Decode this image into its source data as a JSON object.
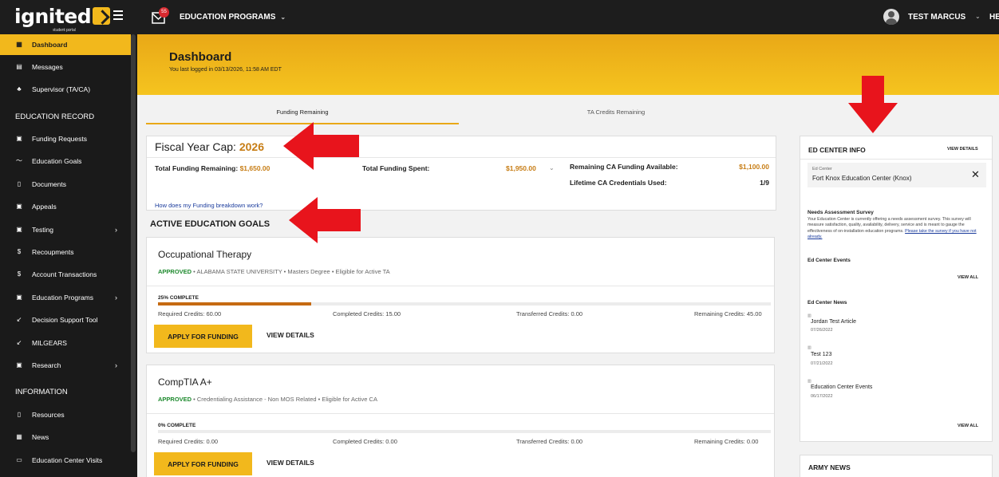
{
  "topbar": {
    "logo": "ignited",
    "logo_sub": "student portal",
    "mail_count": "55",
    "programs_label": "EDUCATION PROGRAMS",
    "username": "TEST MARCUS",
    "help_label": "HE"
  },
  "sidebar": {
    "items": [
      {
        "label": "Dashboard",
        "icon": "dashboard-icon"
      },
      {
        "label": "Messages",
        "icon": "messages-icon"
      },
      {
        "label": "Supervisor (TA/CA)",
        "icon": "supervisor-icon"
      },
      {
        "label": "Funding Requests",
        "icon": "funding-icon"
      },
      {
        "label": "Education Goals",
        "icon": "goals-icon"
      },
      {
        "label": "Documents",
        "icon": "documents-icon"
      },
      {
        "label": "Appeals",
        "icon": "appeals-icon"
      },
      {
        "label": "Testing",
        "icon": "testing-icon"
      },
      {
        "label": "Recoupments",
        "icon": "dollar-icon"
      },
      {
        "label": "Account Transactions",
        "icon": "dollar-icon"
      },
      {
        "label": "Education Programs",
        "icon": "programs-icon"
      },
      {
        "label": "Decision Support Tool",
        "icon": "tool-icon"
      },
      {
        "label": "MILGEARS",
        "icon": "milgears-icon"
      },
      {
        "label": "Research",
        "icon": "research-icon"
      },
      {
        "label": "Resources",
        "icon": "resources-icon"
      },
      {
        "label": "News",
        "icon": "news-icon"
      },
      {
        "label": "Education Center Visits",
        "icon": "calendar-icon"
      }
    ],
    "sections": [
      "EDUCATION RECORD",
      "INFORMATION"
    ]
  },
  "banner": {
    "title": "Dashboard",
    "subtitle": "You last logged in 03/13/2026, 11:58 AM EDT"
  },
  "tabs": [
    "Funding Remaining",
    "TA Credits Remaining"
  ],
  "funding": {
    "title_prefix": "Fiscal Year Cap: ",
    "year": "2026",
    "remaining_label": "Total Funding Remaining: ",
    "remaining_value": "$1,650.00",
    "spent_label": "Total Funding Spent:",
    "spent_value": "$1,950.00",
    "ca_label": "Remaining CA Funding Available:",
    "ca_value": "$1,100.00",
    "lifetime_label": "Lifetime CA Credentials Used:",
    "lifetime_value": "1/9",
    "help_link": "How does my Funding breakdown work?"
  },
  "goals_heading": "ACTIVE EDUCATION GOALS",
  "goals": [
    {
      "title": "Occupational Therapy",
      "status": "APPROVED",
      "meta": " • ALABAMA STATE UNIVERSITY • Masters Degree • Eligible for Active TA",
      "pct_label": "25% COMPLETE",
      "progress": 0.25,
      "required": "Required Credits: 60.00",
      "completed": "Completed Credits: 15.00",
      "transferred": "Transferred Credits: 0.00",
      "remaining": "Remaining Credits: 45.00",
      "apply_label": "APPLY FOR FUNDING",
      "details_label": "VIEW DETAILS"
    },
    {
      "title": "CompTIA A+",
      "status": "APPROVED",
      "meta": " • Credentialing Assistance - Non MOS Related • Eligible for Active CA",
      "pct_label": "0% COMPLETE",
      "progress": 0,
      "required": "Required Credits: 0.00",
      "completed": "Completed Credits: 0.00",
      "transferred": "Transferred Credits: 0.00",
      "remaining": "Remaining Credits: 0.00",
      "apply_label": "APPLY FOR FUNDING",
      "details_label": "VIEW DETAILS"
    }
  ],
  "ed_center": {
    "title": "ED CENTER INFO",
    "view_details": "VIEW DETAILS",
    "field_label": "Ed Center",
    "field_value": "Fort Knox Education Center (Knox)",
    "survey_title": "Needs Assessment Survey",
    "survey_text": "Your Education Center is currently offering a needs assessment survey. This survey will measure satisfaction, quality, availability, delivery, service and is meant to gauge the effectiveness of on-installation education programs. ",
    "survey_link": "Please take the survey if you have not already.",
    "events_title": "Ed Center Events",
    "view_all": "VIEW ALL",
    "news_title": "Ed Center News",
    "news": [
      {
        "title": "Jordan Test Article",
        "date": "07/26/2022"
      },
      {
        "title": "Test 123",
        "date": "07/21/2022"
      },
      {
        "title": "Education Center Events",
        "date": "06/17/2022"
      }
    ]
  },
  "army_news": "ARMY NEWS",
  "colors": {
    "accent": "#f2b81c",
    "funding": "#c77d15",
    "approved": "#1e8a2e",
    "progress": "#c56a12",
    "arrow": "#e8141c"
  }
}
